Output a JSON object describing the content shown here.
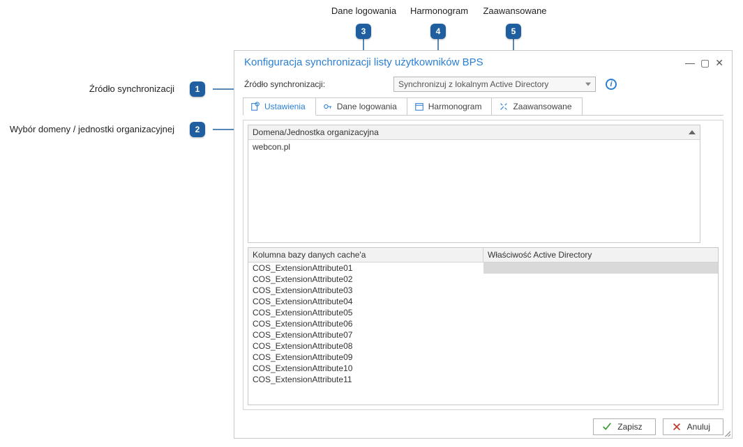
{
  "callouts": {
    "c1": {
      "label": "Źródło synchronizacji",
      "num": "1"
    },
    "c2": {
      "label": "Wybór domeny / jednostki organizacyjnej",
      "num": "2"
    },
    "c3": {
      "label": "Dane logowania",
      "num": "3"
    },
    "c4": {
      "label": "Harmonogram",
      "num": "4"
    },
    "c5": {
      "label": "Zaawansowane",
      "num": "5"
    }
  },
  "window": {
    "title": "Konfiguracja synchronizacji listy użytkowników BPS"
  },
  "source": {
    "label": "Źródło synchronizacji:",
    "selected": "Synchronizuj z lokalnym Active Directory"
  },
  "tabs": {
    "settings": "Ustawienia",
    "credentials": "Dane logowania",
    "schedule": "Harmonogram",
    "advanced": "Zaawansowane"
  },
  "domainPanel": {
    "header": "Domena/Jednostka organizacyjna",
    "rows": [
      "webcon.pl"
    ]
  },
  "cachePanel": {
    "colA": "Kolumna bazy danych cache'a",
    "colB": "Właściwość Active Directory",
    "rowsA": [
      "COS_ExtensionAttribute01",
      "COS_ExtensionAttribute02",
      "COS_ExtensionAttribute03",
      "COS_ExtensionAttribute04",
      "COS_ExtensionAttribute05",
      "COS_ExtensionAttribute06",
      "COS_ExtensionAttribute07",
      "COS_ExtensionAttribute08",
      "COS_ExtensionAttribute09",
      "COS_ExtensionAttribute10",
      "COS_ExtensionAttribute11"
    ]
  },
  "footer": {
    "save": "Zapisz",
    "cancel": "Anuluj"
  }
}
